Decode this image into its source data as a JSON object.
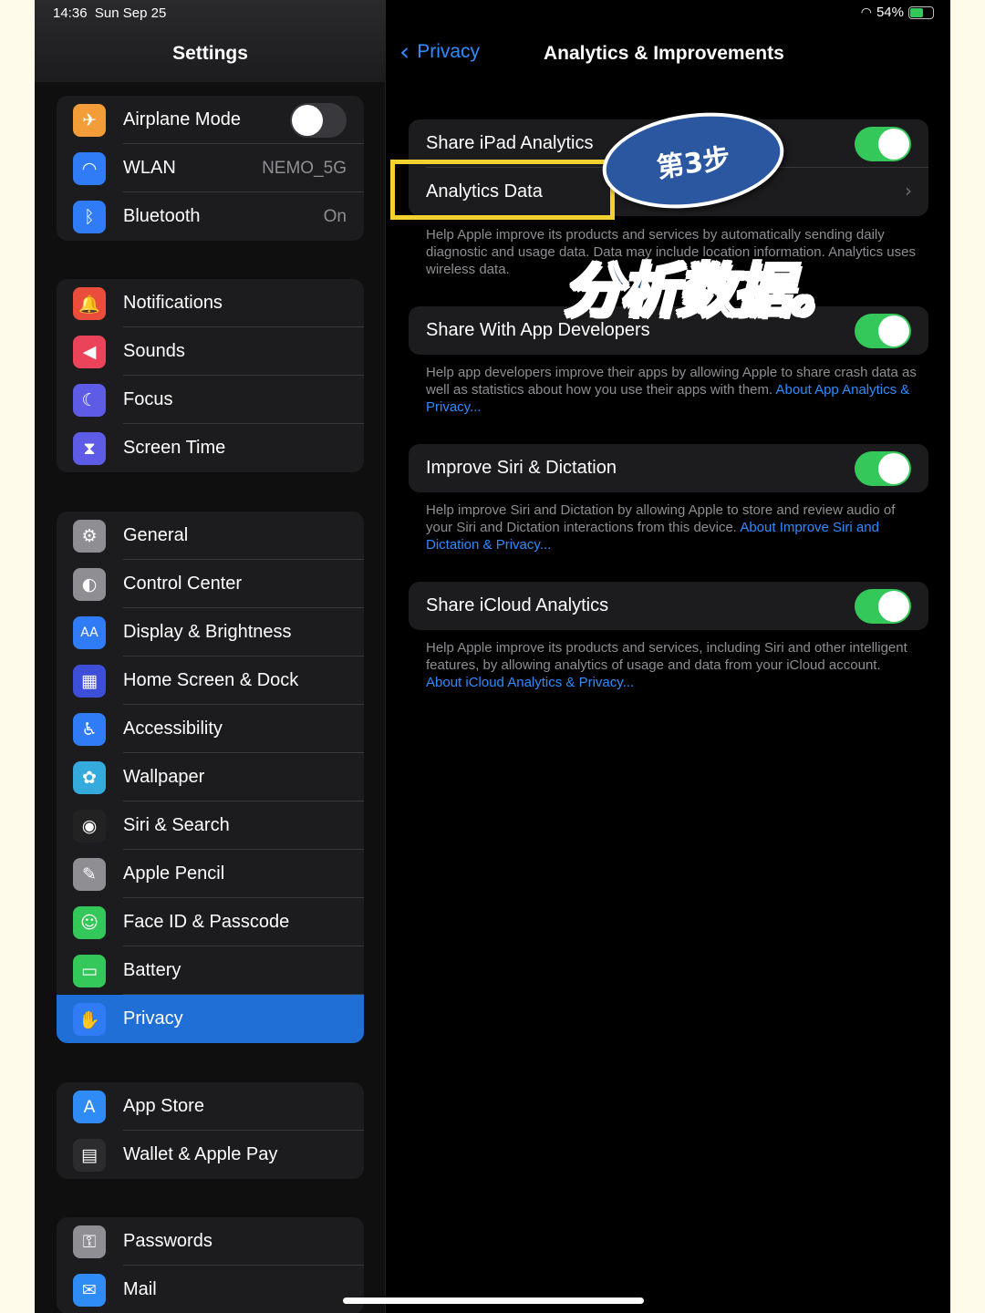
{
  "status_bar": {
    "time": "14:36",
    "date": "Sun Sep 25",
    "battery": "54%"
  },
  "sidebar": {
    "title": "Settings",
    "groups": [
      {
        "items": [
          {
            "label": "Airplane Mode",
            "icon": "airplane-icon",
            "color": "#f29d38",
            "toggle": "off"
          },
          {
            "label": "WLAN",
            "icon": "wifi-icon",
            "color": "#2f7cf6",
            "value": "NEMO_5G"
          },
          {
            "label": "Bluetooth",
            "icon": "bluetooth-icon",
            "color": "#2f7cf6",
            "value": "On"
          }
        ]
      },
      {
        "items": [
          {
            "label": "Notifications",
            "icon": "bell-icon",
            "color": "#eb4d3d"
          },
          {
            "label": "Sounds",
            "icon": "speaker-icon",
            "color": "#eb445a"
          },
          {
            "label": "Focus",
            "icon": "moon-icon",
            "color": "#5e5ce6"
          },
          {
            "label": "Screen Time",
            "icon": "hourglass-icon",
            "color": "#5e5ce6"
          }
        ]
      },
      {
        "items": [
          {
            "label": "General",
            "icon": "gear-icon",
            "color": "#8e8e93"
          },
          {
            "label": "Control Center",
            "icon": "switches-icon",
            "color": "#8e8e93"
          },
          {
            "label": "Display & Brightness",
            "icon": "text-size-icon",
            "color": "#2f7cf6"
          },
          {
            "label": "Home Screen & Dock",
            "icon": "grid-icon",
            "color": "#3d4ed8"
          },
          {
            "label": "Accessibility",
            "icon": "accessibility-icon",
            "color": "#2f7cf6"
          },
          {
            "label": "Wallpaper",
            "icon": "flower-icon",
            "color": "#35aadc"
          },
          {
            "label": "Siri & Search",
            "icon": "siri-icon",
            "color": "#222222"
          },
          {
            "label": "Apple Pencil",
            "icon": "pencil-icon",
            "color": "#8e8e93"
          },
          {
            "label": "Face ID & Passcode",
            "icon": "face-id-icon",
            "color": "#34c759"
          },
          {
            "label": "Battery",
            "icon": "battery-icon",
            "color": "#34c759"
          },
          {
            "label": "Privacy",
            "icon": "hand-icon",
            "color": "#2f7cf6",
            "selected": true
          }
        ]
      },
      {
        "items": [
          {
            "label": "App Store",
            "icon": "app-store-icon",
            "color": "#2f8cf6"
          },
          {
            "label": "Wallet & Apple Pay",
            "icon": "wallet-icon",
            "color": "#2c2c2e"
          }
        ]
      },
      {
        "items": [
          {
            "label": "Passwords",
            "icon": "key-icon",
            "color": "#8e8e93"
          },
          {
            "label": "Mail",
            "icon": "mail-icon",
            "color": "#2f8cf6"
          }
        ]
      }
    ]
  },
  "detail": {
    "back_label": "Privacy",
    "title": "Analytics & Improvements",
    "sections": [
      {
        "rows": [
          {
            "label": "Share iPad Analytics",
            "toggle": "on"
          },
          {
            "label": "Analytics Data",
            "chevron": true
          }
        ],
        "footer": "Help Apple improve its products and services by automatically sending daily diagnostic and usage data. Data may include location information. Analytics uses wireless data.",
        "footer_link": ""
      },
      {
        "rows": [
          {
            "label": "Share With App Developers",
            "toggle": "on"
          }
        ],
        "footer": "Help app developers improve their apps by allowing Apple to share crash data as well as statistics about how you use their apps with them.",
        "footer_link": "About App Analytics & Privacy..."
      },
      {
        "rows": [
          {
            "label": "Improve Siri & Dictation",
            "toggle": "on"
          }
        ],
        "footer": "Help improve Siri and Dictation by allowing Apple to store and review audio of your Siri and Dictation interactions from this device.",
        "footer_link": "About Improve Siri and Dictation & Privacy..."
      },
      {
        "rows": [
          {
            "label": "Share iCloud Analytics",
            "toggle": "on"
          }
        ],
        "footer": "Help Apple improve its products and services, including Siri and other intelligent features, by allowing analytics of usage and data from your iCloud account.",
        "footer_link": "About iCloud Analytics & Privacy..."
      }
    ]
  },
  "overlay": {
    "step_badge": "第3步",
    "caption": "分析数据。"
  },
  "colors": {
    "accent": "#2e8cff",
    "toggle_on": "#34c759",
    "highlight": "#f1d230",
    "selected": "#1f6fd6"
  }
}
